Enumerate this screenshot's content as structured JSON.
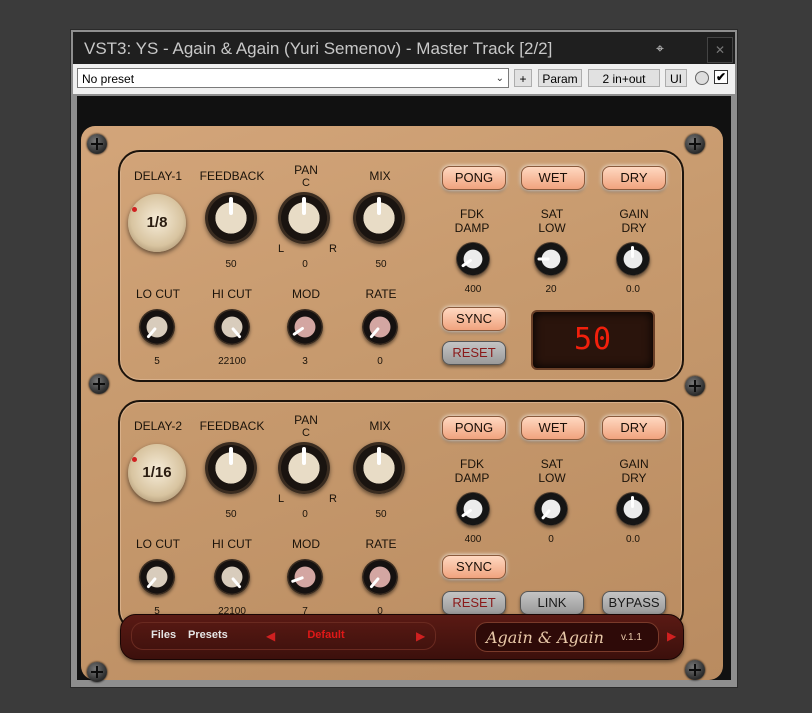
{
  "window": {
    "title": "VST3: YS - Again & Again (Yuri Semenov) - Master Track [2/2]",
    "pin_icon": "pin-icon",
    "close_icon": "close-icon"
  },
  "toolbar": {
    "preset_value": "No preset",
    "plus_label": "+",
    "param_label": "Param",
    "io_label": "2 in+out",
    "ui_label": "UI",
    "enabled_check": "✔"
  },
  "delay1": {
    "delay_label": "DELAY-1",
    "delay_value": "1/8",
    "feedback_label": "FEEDBACK",
    "feedback_value": "50",
    "pan_label": "PAN",
    "pan_c": "C",
    "pan_l": "L",
    "pan_r": "R",
    "pan_value": "0",
    "mix_label": "MIX",
    "mix_value": "50",
    "locut_label": "LO CUT",
    "locut_value": "5",
    "hicut_label": "HI CUT",
    "hicut_value": "22100",
    "mod_label": "MOD",
    "mod_value": "3",
    "rate_label": "RATE",
    "rate_value": "0",
    "pong_label": "PONG",
    "wet_label": "WET",
    "dry_label": "DRY",
    "fdk_damp_label": "FDK\nDAMP",
    "fdk_damp_value": "400",
    "sat_low_label": "SAT\nLOW",
    "sat_low_value": "20",
    "gain_dry_label": "GAIN\nDRY",
    "gain_dry_value": "0.0",
    "sync_label": "SYNC",
    "reset_label": "RESET",
    "display_value": "50"
  },
  "delay2": {
    "delay_label": "DELAY-2",
    "delay_value": "1/16",
    "feedback_label": "FEEDBACK",
    "feedback_value": "50",
    "pan_label": "PAN",
    "pan_c": "C",
    "pan_l": "L",
    "pan_r": "R",
    "pan_value": "0",
    "mix_label": "MIX",
    "mix_value": "50",
    "locut_label": "LO CUT",
    "locut_value": "5",
    "hicut_label": "HI CUT",
    "hicut_value": "22100",
    "mod_label": "MOD",
    "mod_value": "7",
    "rate_label": "RATE",
    "rate_value": "0",
    "pong_label": "PONG",
    "wet_label": "WET",
    "dry_label": "DRY",
    "fdk_damp_label": "FDK\nDAMP",
    "fdk_damp_value": "400",
    "sat_low_label": "SAT\nLOW",
    "sat_low_value": "0",
    "gain_dry_label": "GAIN\nDRY",
    "gain_dry_value": "0.0",
    "sync_label": "SYNC",
    "reset_label": "RESET",
    "link_label": "LINK",
    "bypass_label": "BYPASS"
  },
  "footer": {
    "files_label": "Files",
    "presets_label": "Presets",
    "current_preset": "Default",
    "logo_text": "Again & Again",
    "version": "v.1.1"
  }
}
